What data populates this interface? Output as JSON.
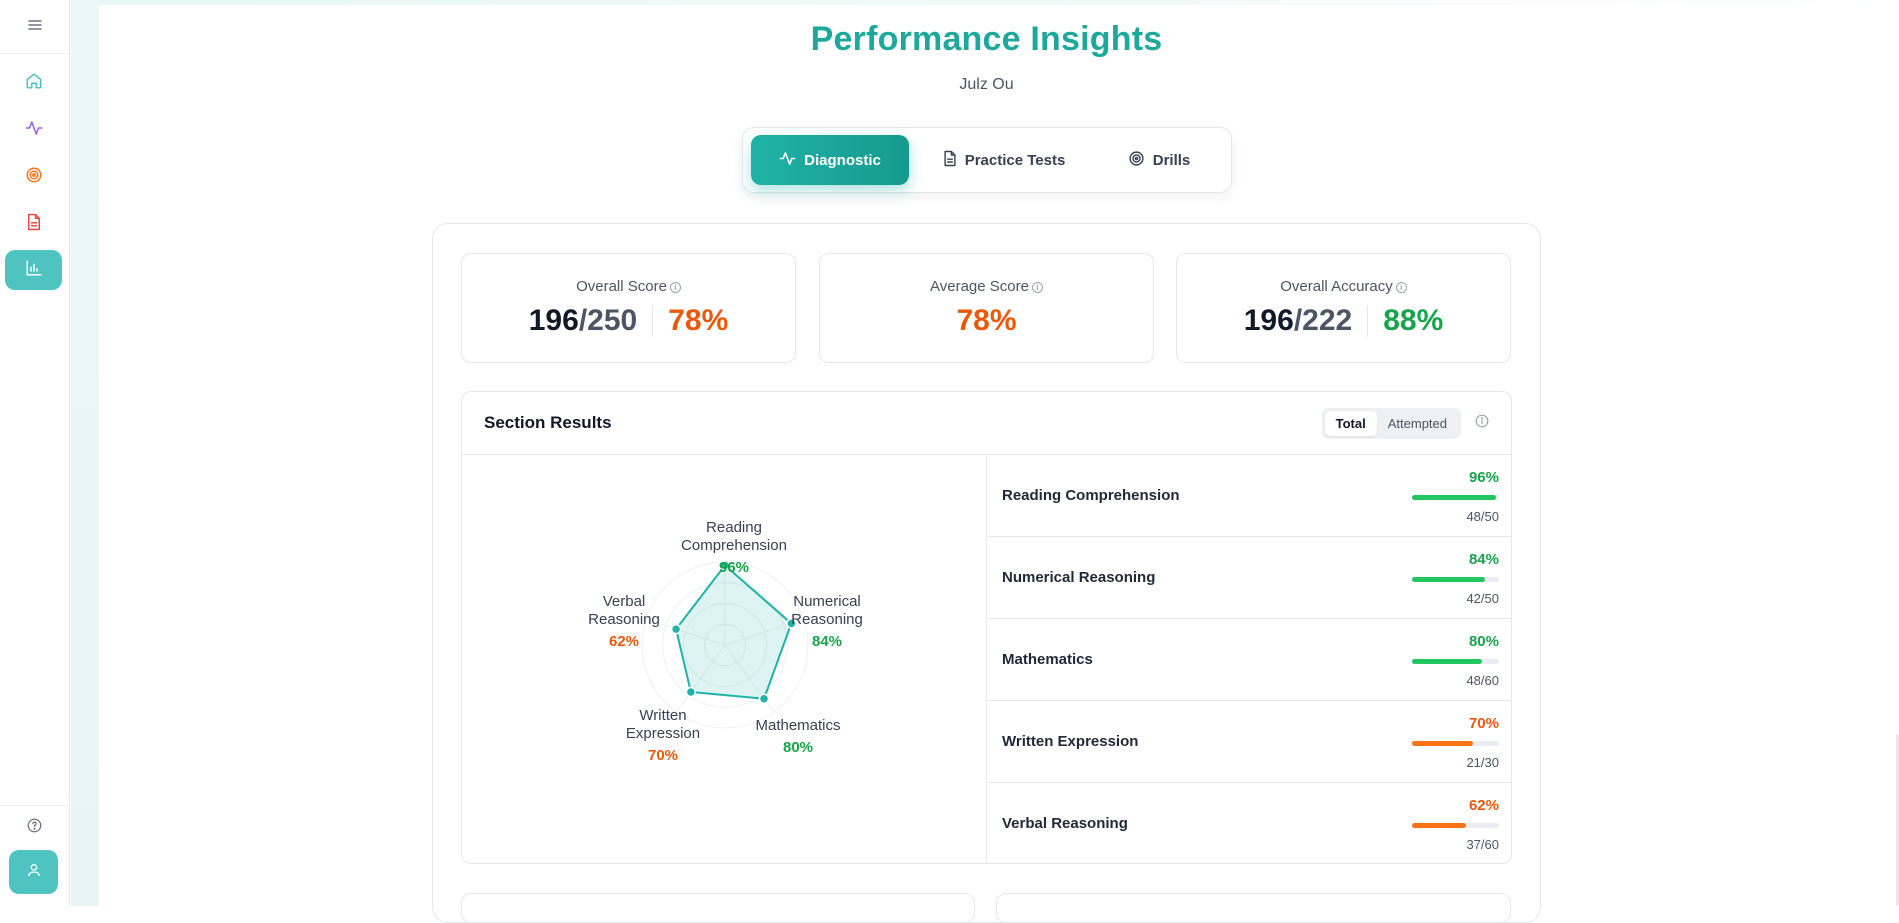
{
  "sidebar": {
    "icons": [
      "menu-icon",
      "home-icon",
      "activity-icon",
      "target-icon",
      "document-icon",
      "bar-chart-icon"
    ],
    "bottom": [
      "help-icon",
      "user-icon"
    ],
    "colors": {
      "home": "#4fc3c0",
      "activity": "#9b5de5",
      "target": "#f97316",
      "document": "#ef4444",
      "active_bg": "#4fc3c0"
    }
  },
  "header": {
    "title": "Performance Insights",
    "student": "Julz Ou"
  },
  "tabs": [
    {
      "label": "Diagnostic",
      "icon": "activity-icon",
      "active": true
    },
    {
      "label": "Practice Tests",
      "icon": "document-icon",
      "active": false
    },
    {
      "label": "Drills",
      "icon": "target-icon",
      "active": false
    }
  ],
  "stats": {
    "overall_score": {
      "label": "Overall Score",
      "score": "196",
      "total": "/250",
      "percent": "78%"
    },
    "average_score": {
      "label": "Average Score",
      "percent": "78%"
    },
    "overall_accuracy": {
      "label": "Overall Accuracy",
      "score": "196",
      "total": "/222",
      "percent": "88%"
    }
  },
  "section_results": {
    "title": "Section Results",
    "toggle": [
      "Total",
      "Attempted"
    ],
    "toggle_selected": "Total",
    "rows": [
      {
        "name": "Reading Comprehension",
        "percent": "96%",
        "fraction": "48/50",
        "value": 0.96,
        "level": "good"
      },
      {
        "name": "Numerical Reasoning",
        "percent": "84%",
        "fraction": "42/50",
        "value": 0.84,
        "level": "good"
      },
      {
        "name": "Mathematics",
        "percent": "80%",
        "fraction": "48/60",
        "value": 0.8,
        "level": "good"
      },
      {
        "name": "Written Expression",
        "percent": "70%",
        "fraction": "21/30",
        "value": 0.7,
        "level": "warn"
      },
      {
        "name": "Verbal Reasoning",
        "percent": "62%",
        "fraction": "37/60",
        "value": 0.62,
        "level": "warn"
      }
    ],
    "radar": {
      "labels": [
        {
          "line1": "Reading",
          "line2": "Comprehension",
          "percent": "96%"
        },
        {
          "line1": "Numerical",
          "line2": "Reasoning",
          "percent": "84%"
        },
        {
          "line1": "Mathematics",
          "line2": "",
          "percent": "80%"
        },
        {
          "line1": "Written",
          "line2": "Expression",
          "percent": "70%"
        },
        {
          "line1": "Verbal",
          "line2": "Reasoning",
          "percent": "62%"
        }
      ]
    }
  },
  "colors": {
    "brand": "#1ea89c",
    "good": "#16a34a",
    "good_bar": "#22c55e",
    "warn": "#ea580c",
    "warn_bar": "#f97316"
  }
}
